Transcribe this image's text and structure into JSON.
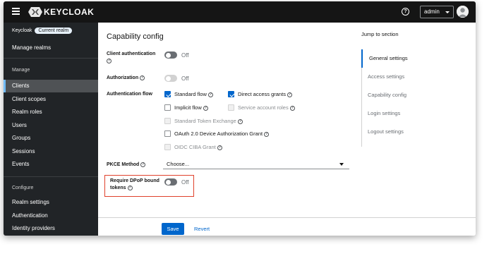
{
  "masthead": {
    "logo_text": "KEYCLOAK",
    "help_icon": "question-circle-icon",
    "user_label": "admin"
  },
  "sidebar": {
    "realm_name": "Keycloak",
    "realm_badge": "Current realm",
    "manage_realms": "Manage realms",
    "section_manage": "Manage",
    "manage_items": [
      "Clients",
      "Client scopes",
      "Realm roles",
      "Users",
      "Groups",
      "Sessions",
      "Events"
    ],
    "active_item": "Clients",
    "section_configure": "Configure",
    "configure_items": [
      "Realm settings",
      "Authentication",
      "Identity providers"
    ]
  },
  "form": {
    "title": "Capability config",
    "client_auth_label": "Client authentication",
    "client_auth_state": "Off",
    "authorization_label": "Authorization",
    "authorization_state": "Off",
    "auth_flow_label": "Authentication flow",
    "flows": {
      "standard": {
        "label": "Standard flow",
        "checked": true
      },
      "direct": {
        "label": "Direct access grants",
        "checked": true
      },
      "implicit": {
        "label": "Implicit flow",
        "checked": false
      },
      "service": {
        "label": "Service account roles",
        "checked": false,
        "disabled": true
      },
      "token_exchange": {
        "label": "Standard Token Exchange",
        "checked": false,
        "disabled": true
      },
      "oauth_device": {
        "label": "OAuth 2.0 Device Authorization Grant",
        "checked": false
      },
      "oidc_ciba": {
        "label": "OIDC CIBA Grant",
        "checked": false,
        "disabled": true
      }
    },
    "pkce_label": "PKCE Method",
    "pkce_value": "Choose...",
    "dpop_label_line1": "Require DPoP bound",
    "dpop_label_line2": "tokens",
    "dpop_state": "Off",
    "save_label": "Save",
    "revert_label": "Revert"
  },
  "jump": {
    "title": "Jump to section",
    "items": [
      "General settings",
      "Access settings",
      "Capability config",
      "Login settings",
      "Logout settings"
    ],
    "active": "General settings"
  },
  "colors": {
    "masthead": "#151515",
    "sidebar": "#212427",
    "primary": "#0066cc",
    "highlight": "#e0412c"
  }
}
